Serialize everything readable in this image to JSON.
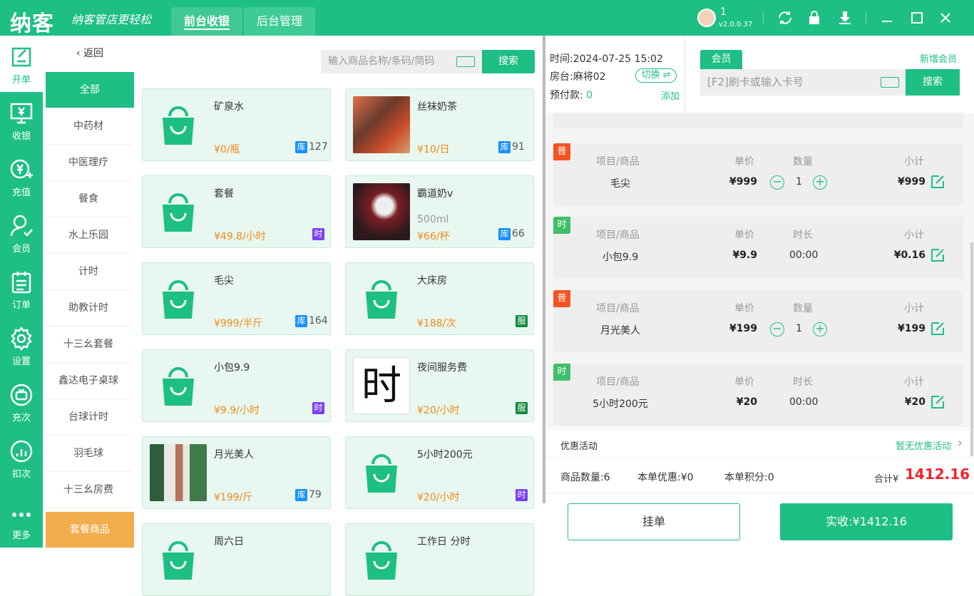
{
  "app": {
    "logo": "纳客",
    "slogan": "纳客管店更轻松",
    "user": "1",
    "version": "v2.0.0.37"
  },
  "tabs": [
    {
      "label": "前台收银"
    },
    {
      "label": "后台管理"
    }
  ],
  "sidebar": {
    "items": [
      {
        "label": "开单",
        "icon": "edit-icon"
      },
      {
        "label": "收银",
        "icon": "cashier-icon"
      },
      {
        "label": "充值",
        "icon": "recharge-icon"
      },
      {
        "label": "会员",
        "icon": "member-icon"
      },
      {
        "label": "订单",
        "icon": "order-icon"
      },
      {
        "label": "设置",
        "icon": "gear-icon"
      },
      {
        "label": "充次",
        "icon": "recharge-count-icon"
      },
      {
        "label": "扣次",
        "icon": "deduct-count-icon"
      },
      {
        "label": "更多",
        "icon": "more-icon"
      }
    ]
  },
  "categories": {
    "back": "返回",
    "items": [
      "全部",
      "中药材",
      "中医理疗",
      "餐食",
      "水上乐园",
      "计时",
      "助教计时",
      "十三幺套餐",
      "鑫达电子桌球",
      "台球计时",
      "羽毛球",
      "十三幺房费",
      "套餐商品"
    ]
  },
  "goods_search": {
    "placeholder": "输入商品名称/条码/简码",
    "button": "搜索"
  },
  "products": [
    {
      "name": "矿泉水",
      "sub": "",
      "price": "¥0/瓶",
      "badge": "库",
      "stock": "127"
    },
    {
      "name": "丝袜奶茶",
      "sub": "",
      "price": "¥10/日",
      "badge": "库",
      "stock": "91"
    },
    {
      "name": "套餐",
      "sub": "",
      "price": "¥49.8/小时",
      "badge": "时",
      "stock": ""
    },
    {
      "name": "霸道奶v",
      "sub": "500ml",
      "price": "¥66/杯",
      "badge": "库",
      "stock": "66"
    },
    {
      "name": "毛尖",
      "sub": "",
      "price": "¥999/半斤",
      "badge": "库",
      "stock": "164"
    },
    {
      "name": "大床房",
      "sub": "",
      "price": "¥188/次",
      "badge": "服",
      "stock": ""
    },
    {
      "name": "小包9.9",
      "sub": "",
      "price": "¥9.9/小时",
      "badge": "时",
      "stock": ""
    },
    {
      "name": "夜间服务费",
      "sub": "",
      "price": "¥20/小时",
      "badge": "服",
      "stock": ""
    },
    {
      "name": "月光美人",
      "sub": "",
      "price": "¥199/斤",
      "badge": "库",
      "stock": "79"
    },
    {
      "name": "5小时200元",
      "sub": "",
      "price": "¥20/小时",
      "badge": "时",
      "stock": ""
    },
    {
      "name": "周六日",
      "sub": "",
      "price": "",
      "badge": "",
      "stock": ""
    },
    {
      "name": "工作日 分时",
      "sub": "",
      "price": "",
      "badge": "",
      "stock": ""
    }
  ],
  "night_fee_glyph": "时",
  "order_info": {
    "time_label": "时间:",
    "time": "2024-07-25 15:02",
    "room_label": "房台:",
    "room": "麻将02",
    "switch": "切换",
    "prepay_label": "预付款:",
    "prepay": "0",
    "add": "添加"
  },
  "member": {
    "tab": "会员",
    "new": "新增会员",
    "placeholder": "[F2]刷卡或输入卡号",
    "button": "搜索"
  },
  "headers": {
    "item": "项目/商品",
    "price": "单价",
    "qty": "数量",
    "duration": "时长",
    "subtotal": "小计"
  },
  "order_items": [
    {
      "tag": "普",
      "name": "毛尖",
      "price": "¥999",
      "qty": "1",
      "duration": "",
      "subtotal": "¥999",
      "type": "qty"
    },
    {
      "tag": "时",
      "name": "小包9.9",
      "price": "¥9.9",
      "qty": "",
      "duration": "00:00",
      "subtotal": "¥0.16",
      "type": "time"
    },
    {
      "tag": "普",
      "name": "月光美人",
      "price": "¥199",
      "qty": "1",
      "duration": "",
      "subtotal": "¥199",
      "type": "qty"
    },
    {
      "tag": "时",
      "name": "5小时200元",
      "price": "¥20",
      "qty": "",
      "duration": "00:00",
      "subtotal": "¥20",
      "type": "time"
    }
  ],
  "promo": {
    "label": "优惠活动",
    "value": "暂无优惠活动"
  },
  "summary": {
    "count": "商品数量:6",
    "discount": "本单优惠:¥0",
    "points": "本单积分:0",
    "total_label": "合计¥",
    "total": "1412.16"
  },
  "actions": {
    "hold": "挂单",
    "pay": "实收:¥1412.16"
  },
  "colors": {
    "brand": "#1dbf84",
    "orange": "#f28a1b",
    "red": "#f5222d"
  }
}
